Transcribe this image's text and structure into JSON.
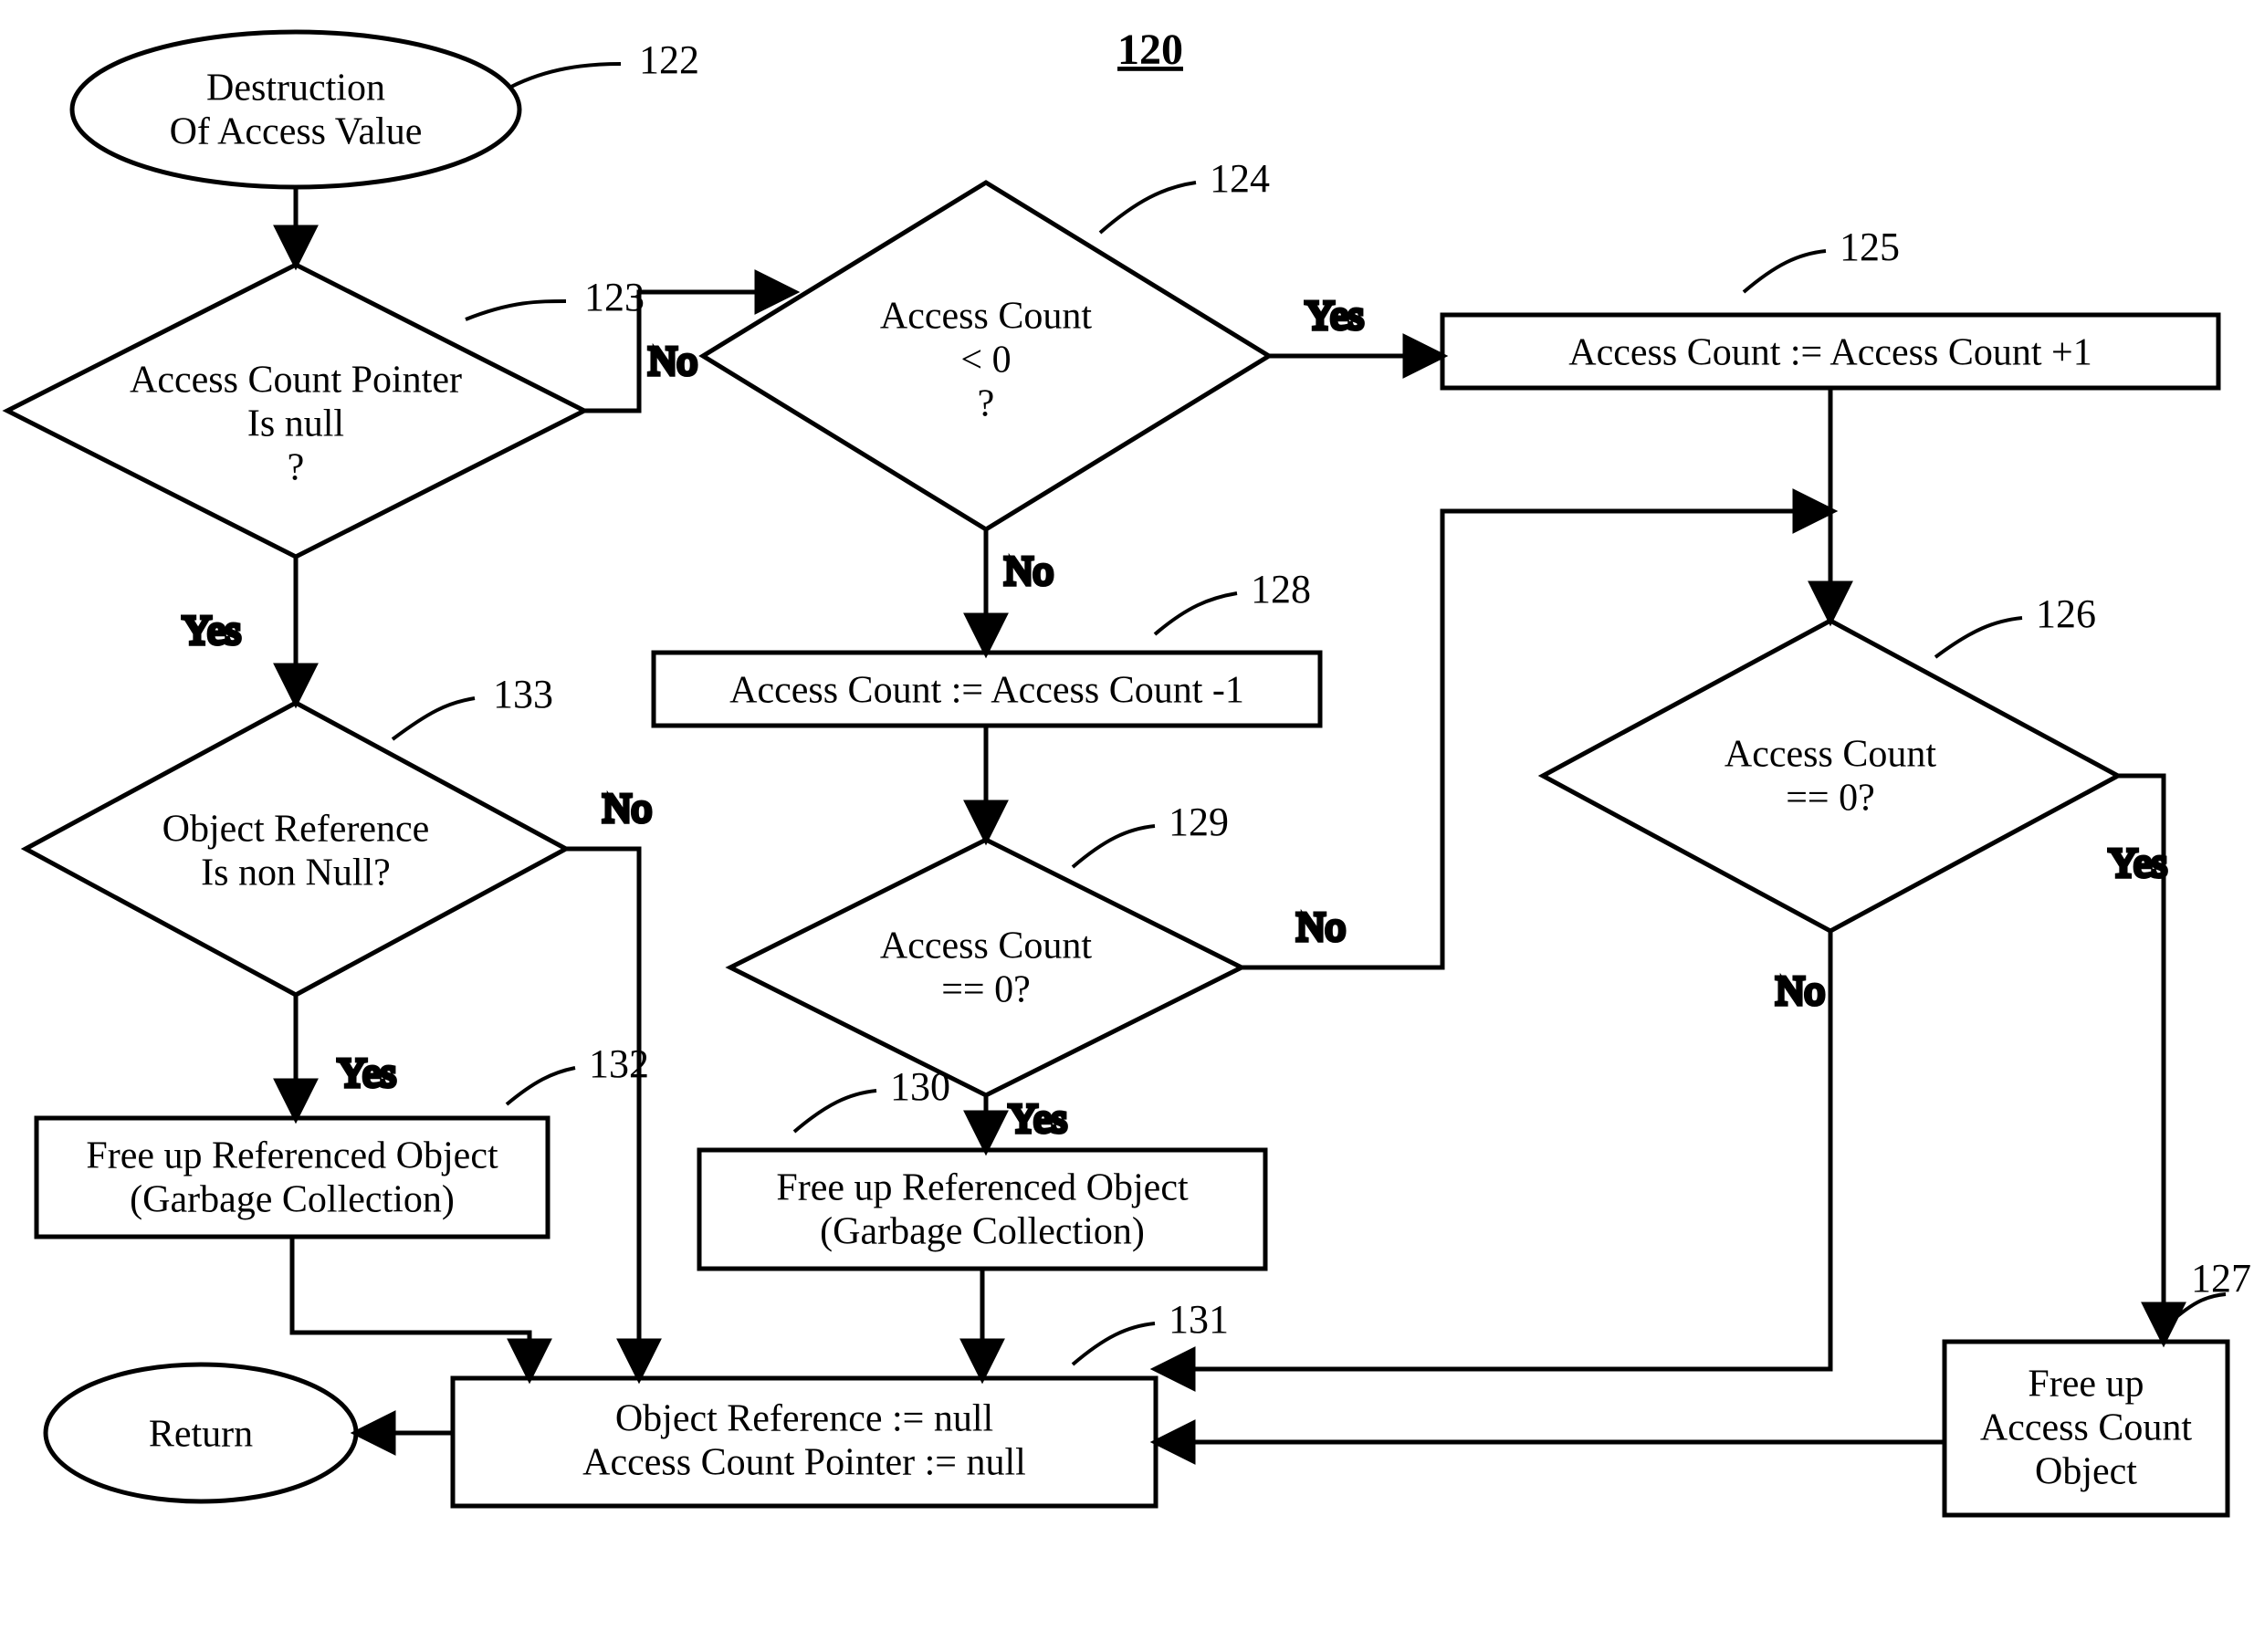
{
  "figure_number": "120",
  "nodes": {
    "n122": {
      "ref": "122",
      "lines": [
        "Destruction",
        "Of Access Value"
      ]
    },
    "n123": {
      "ref": "123",
      "lines": [
        "Access Count Pointer",
        "Is null",
        "?"
      ]
    },
    "n124": {
      "ref": "124",
      "lines": [
        "Access Count",
        "< 0",
        "?"
      ]
    },
    "n125": {
      "ref": "125",
      "lines": [
        "Access Count := Access Count +1"
      ]
    },
    "n126": {
      "ref": "126",
      "lines": [
        "Access Count",
        "== 0?"
      ]
    },
    "n127": {
      "ref": "127",
      "lines": [
        "Free up",
        "Access Count",
        "Object"
      ]
    },
    "n128": {
      "ref": "128",
      "lines": [
        "Access Count := Access Count -1"
      ]
    },
    "n129": {
      "ref": "129",
      "lines": [
        "Access Count",
        "== 0?"
      ]
    },
    "n130": {
      "ref": "130",
      "lines": [
        "Free up Referenced Object",
        "(Garbage Collection)"
      ]
    },
    "n131": {
      "ref": "131",
      "lines": [
        "Object Reference :=  null",
        "Access Count Pointer :=  null"
      ]
    },
    "n132": {
      "ref": "132",
      "lines": [
        "Free up Referenced Object",
        "(Garbage Collection)"
      ]
    },
    "n133": {
      "ref": "133",
      "lines": [
        "Object Reference",
        "Is non Null?"
      ]
    },
    "nreturn": {
      "ref": "",
      "lines": [
        "Return"
      ]
    }
  },
  "edge_labels": {
    "yes": "Yes",
    "no": "No"
  }
}
